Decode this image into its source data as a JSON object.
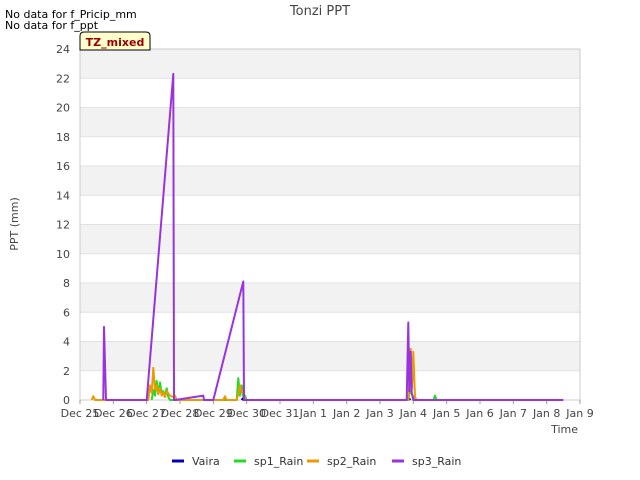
{
  "notes": [
    "No data for f_Pricip_mm",
    "No data for f_ppt"
  ],
  "badge": "TZ_mixed",
  "chart_data": {
    "type": "line",
    "title": "Tonzi PPT",
    "xlabel": "Time",
    "ylabel": "PPT (mm)",
    "ylim": [
      0,
      24
    ],
    "yticks": [
      0,
      2,
      4,
      6,
      8,
      10,
      12,
      14,
      16,
      18,
      20,
      22,
      24
    ],
    "xlim": [
      0,
      15
    ],
    "xticks": [
      {
        "pos": 0,
        "label": "Dec 25"
      },
      {
        "pos": 1,
        "label": "Dec 26"
      },
      {
        "pos": 2,
        "label": "Dec 27"
      },
      {
        "pos": 3,
        "label": "Dec 28"
      },
      {
        "pos": 4,
        "label": "Dec 29"
      },
      {
        "pos": 5,
        "label": "Dec 30"
      },
      {
        "pos": 6,
        "label": "Dec 31"
      },
      {
        "pos": 7,
        "label": "Jan 1"
      },
      {
        "pos": 8,
        "label": "Jan 2"
      },
      {
        "pos": 9,
        "label": "Jan 3"
      },
      {
        "pos": 10,
        "label": "Jan 4"
      },
      {
        "pos": 11,
        "label": "Jan 5"
      },
      {
        "pos": 12,
        "label": "Jan 6"
      },
      {
        "pos": 13,
        "label": "Jan 7"
      },
      {
        "pos": 14,
        "label": "Jan 8"
      },
      {
        "pos": 15,
        "label": "Jan 9"
      }
    ],
    "grid": true,
    "legend_position": "bottom",
    "series": [
      {
        "name": "Vaira",
        "color": "#0000bb",
        "x": [
          4.85,
          4.88,
          4.91,
          9.85,
          9.88,
          9.91
        ],
        "y": [
          0,
          0.1,
          0,
          0,
          0.1,
          0
        ]
      },
      {
        "name": "sp1_Rain",
        "color": "#22dd22",
        "x": [
          2.15,
          2.2,
          2.25,
          2.3,
          2.35,
          2.4,
          2.45,
          2.5,
          2.55,
          2.6,
          2.65,
          2.7,
          4.7,
          4.75,
          4.8,
          4.85,
          4.9,
          4.95,
          5.0,
          9.85,
          9.9,
          9.95,
          10.0,
          10.05,
          10.6,
          10.65,
          10.7
        ],
        "y": [
          0,
          0.7,
          0.3,
          1.3,
          0.4,
          1.2,
          0.5,
          0.6,
          0.3,
          0.8,
          0.2,
          0,
          0,
          1.5,
          0.3,
          1.0,
          0.2,
          0.3,
          0,
          0,
          0.7,
          0.4,
          0.2,
          0,
          0,
          0.3,
          0
        ]
      },
      {
        "name": "sp2_Rain",
        "color": "#ee9900",
        "x": [
          0.35,
          0.4,
          0.45,
          2.05,
          2.1,
          2.15,
          2.2,
          2.25,
          2.3,
          2.35,
          2.4,
          2.45,
          2.5,
          2.55,
          2.6,
          2.7,
          2.8,
          2.85,
          2.9,
          4.3,
          4.35,
          4.4,
          4.7,
          4.75,
          4.8,
          4.85,
          4.9,
          4.95,
          9.85,
          9.88,
          9.92,
          9.96,
          10.0,
          10.05,
          10.1
        ],
        "y": [
          0,
          0.25,
          0,
          0,
          1.0,
          0.5,
          2.2,
          0.7,
          1.0,
          0.4,
          0.8,
          0.3,
          0.5,
          0.2,
          0.6,
          0.3,
          0.2,
          0.3,
          0,
          0,
          0.25,
          0,
          0,
          0.4,
          1.0,
          0.5,
          0.6,
          0,
          0,
          1.2,
          3.5,
          0.8,
          3.3,
          0.2,
          0
        ]
      },
      {
        "name": "sp3_Rain",
        "color": "#9933dd",
        "x": [
          0.7,
          0.72,
          0.78,
          2.0,
          2.8,
          2.82,
          2.86,
          3.7,
          3.72,
          3.75,
          4.0,
          4.9,
          4.92,
          4.95,
          9.8,
          9.85,
          9.88,
          9.92,
          9.95,
          9.98,
          10.0,
          10.05,
          14.5
        ],
        "y": [
          0,
          5.0,
          0,
          0,
          22.3,
          0,
          0,
          0.3,
          0,
          0,
          0,
          8.1,
          0,
          0,
          0,
          5.3,
          0.6,
          3.3,
          0.5,
          0.2,
          0,
          0,
          0
        ]
      }
    ]
  }
}
